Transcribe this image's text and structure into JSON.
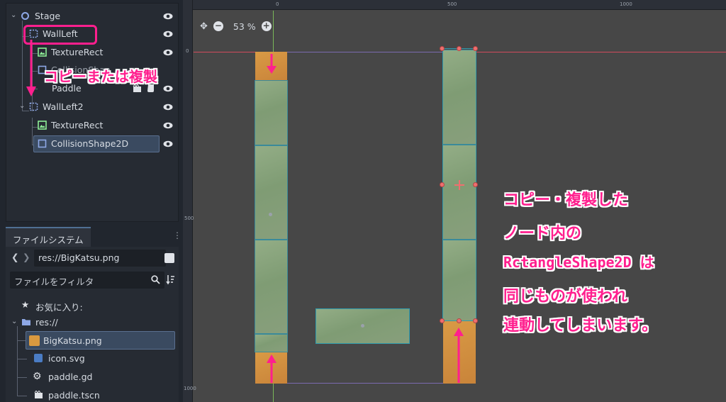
{
  "scene_tree": {
    "items": [
      {
        "label": "Stage"
      },
      {
        "label": "WallLeft"
      },
      {
        "label": "TextureRect"
      },
      {
        "label": "CollisionShap"
      },
      {
        "label": "Paddle"
      },
      {
        "label": "WallLeft2"
      },
      {
        "label": "TextureRect"
      },
      {
        "label": "CollisionShape2D"
      }
    ]
  },
  "filesystem": {
    "tab_label": "ファイルシステム",
    "path_value": "res://BigKatsu.png",
    "filter_placeholder": "ファイルをフィルタ",
    "favorites_label": "お気に入り:",
    "items": [
      {
        "label": "res://"
      },
      {
        "label": "BigKatsu.png"
      },
      {
        "label": "icon.svg"
      },
      {
        "label": "paddle.gd"
      },
      {
        "label": "paddle.tscn"
      }
    ]
  },
  "viewport": {
    "zoom_label": "53 %",
    "ruler_top": [
      "0",
      "500",
      "1000"
    ],
    "ruler_left": [
      "0",
      "500",
      "1000"
    ]
  },
  "annotations": {
    "copy_note": "コピーまたは複製",
    "explanation": [
      "コピー・複製した",
      "ノード内の",
      "RctangleShape2D  は",
      "同じものが使われ",
      "連動してしまいます。"
    ]
  },
  "colors": {
    "annotation": "#ff1f8e",
    "selection": "#3a4a60",
    "viewport_bg": "#474747"
  }
}
